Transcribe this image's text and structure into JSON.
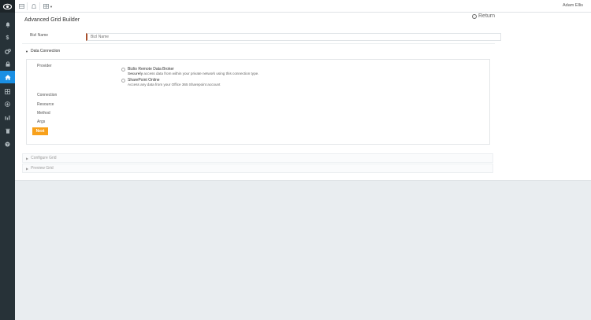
{
  "topbar": {
    "user_name": "Adam Ellis"
  },
  "page": {
    "title": "Advanced Grid Builder",
    "return_label": "Return"
  },
  "bizi_name": {
    "label": "BizI Name",
    "placeholder": "BizI Name",
    "value": ""
  },
  "data_connection": {
    "header": "Data Connection",
    "provider_label": "Provider",
    "providers": [
      {
        "name": "Bizlio Remote Data Broker",
        "desc_bold": "Securely",
        "desc": " access data from within your private network using this connection type."
      },
      {
        "name": "SharePoint Online",
        "desc_bold": "",
        "desc": "Access any data from your Office 365 Sharepoint account"
      }
    ],
    "connection_label": "Connection",
    "resource_label": "Resource",
    "method_label": "Method",
    "args_label": "Args",
    "next_label": "Next"
  },
  "configure_grid": {
    "header": "Configure Grid"
  },
  "preview_grid": {
    "header": "Preview Grid"
  },
  "colors": {
    "sidebar": "#273238",
    "active": "#1a8fe3",
    "next_button": "#f8a11b",
    "input_accent": "#a94f2c"
  },
  "sidebar": {
    "icons": [
      "logo-cloud-icon",
      "bell-icon",
      "dollar-icon",
      "gears-icon",
      "lock-icon",
      "home-icon",
      "grid-icon",
      "plus-circle-icon",
      "bar-chart-icon",
      "trash-icon",
      "help-icon"
    ]
  }
}
